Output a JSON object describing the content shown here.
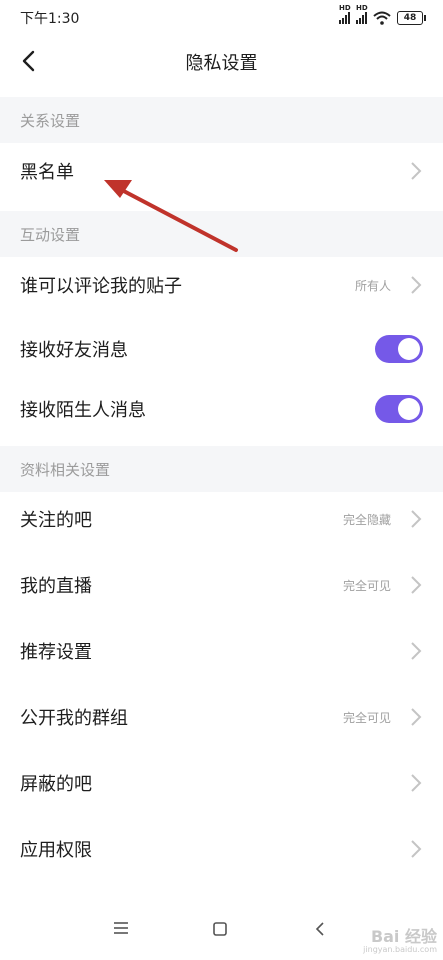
{
  "status_bar": {
    "time": "下午1:30",
    "battery": "48",
    "network_labels": [
      "HD",
      "HD"
    ]
  },
  "nav": {
    "title": "隐私设置"
  },
  "sections": [
    {
      "header": "关系设置",
      "rows": [
        {
          "label": "黑名单",
          "type": "link"
        }
      ]
    },
    {
      "header": "互动设置",
      "rows": [
        {
          "label": "谁可以评论我的贴子",
          "value": "所有人",
          "type": "link"
        },
        {
          "label": "接收好友消息",
          "type": "toggle",
          "on": true
        },
        {
          "label": "接收陌生人消息",
          "type": "toggle",
          "on": true
        }
      ]
    },
    {
      "header": "资料相关设置",
      "rows": [
        {
          "label": "关注的吧",
          "value": "完全隐藏",
          "type": "link"
        },
        {
          "label": "我的直播",
          "value": "完全可见",
          "type": "link"
        },
        {
          "label": "推荐设置",
          "type": "link"
        },
        {
          "label": "公开我的群组",
          "value": "完全可见",
          "type": "link"
        },
        {
          "label": "屏蔽的吧",
          "type": "link"
        },
        {
          "label": "应用权限",
          "type": "link"
        }
      ]
    }
  ],
  "icons": {
    "back": "chevron-left-icon",
    "chevron": "chevron-right-icon",
    "menu": "menu-icon",
    "home": "home-square-icon",
    "nav_back": "back-triangle-icon",
    "wifi": "wifi-icon",
    "signal": "signal-icon",
    "battery": "battery-icon"
  },
  "colors": {
    "accent": "#7559e8",
    "annotation_arrow": "#c0332b",
    "section_bg": "#f5f6f8"
  },
  "watermark": {
    "brand": "Bai 经验",
    "sub": "jingyan.baidu.com"
  }
}
